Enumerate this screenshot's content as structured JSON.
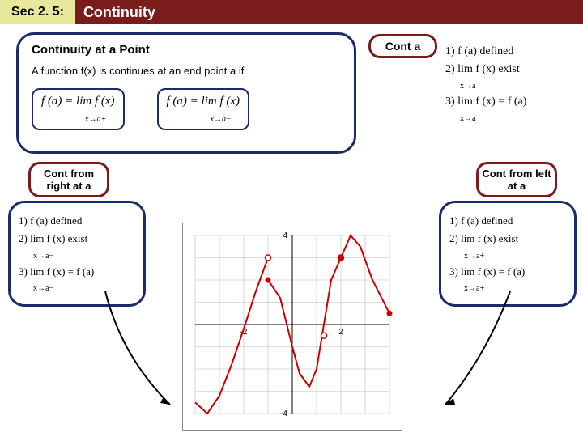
{
  "header": {
    "section_label": "Sec 2. 5:",
    "title": "Continuity"
  },
  "top_box": {
    "title": "Continuity at a Point",
    "description": "A  function  f(x)  is continues at an end point  a  if",
    "eq_left": "f (a) = lim  f (x)",
    "eq_left_sub": "x→a+",
    "eq_right": "f (a) = lim  f (x)",
    "eq_right_sub": "x→a−"
  },
  "cont_a_label": "Cont  a",
  "cont_right_label": "Cont from right at a",
  "cont_left_label": "Cont from left at a",
  "conditions_a": {
    "c1": "1) f (a)  defined",
    "c2": "2) lim f (x)  exist",
    "c2_sub": "x→a",
    "c3": "3) lim f (x) = f (a)",
    "c3_sub": "x→a"
  },
  "conditions_left_panel": {
    "c1": "1) f (a)  defined",
    "c2": "2) lim f (x)  exist",
    "c2_sub": "x→a−",
    "c3": "3) lim f (x) = f (a)",
    "c3_sub": "x→a−"
  },
  "conditions_right_panel": {
    "c1": "1) f (a)  defined",
    "c2": "2) lim f (x)  exist",
    "c2_sub": "x→a+",
    "c3": "3) lim f (x) = f (a)",
    "c3_sub": "x→a+"
  },
  "chart_data": {
    "type": "line",
    "title": "",
    "xlabel": "",
    "ylabel": "",
    "xlim": [
      -4,
      4
    ],
    "ylim": [
      -4,
      4
    ],
    "x_ticks": [
      -2,
      2
    ],
    "y_ticks": [
      -4,
      4
    ],
    "segments": [
      {
        "name": "piece1",
        "points": [
          [
            -4,
            -3.5
          ],
          [
            -3.5,
            -4
          ],
          [
            -3,
            -3.2
          ],
          [
            -2.5,
            -1.8
          ],
          [
            -2,
            -0.2
          ],
          [
            -1.5,
            1.5
          ],
          [
            -1,
            3
          ]
        ],
        "end_open": true
      },
      {
        "name": "piece2",
        "points": [
          [
            -1,
            2
          ],
          [
            -0.5,
            1.2
          ],
          [
            0,
            -1
          ],
          [
            0.3,
            -2.2
          ],
          [
            0.7,
            -2.8
          ],
          [
            1,
            -2
          ],
          [
            1.3,
            0
          ],
          [
            1.6,
            2
          ],
          [
            2,
            3
          ]
        ],
        "start_closed": true,
        "end_open": true
      },
      {
        "name": "piece3",
        "points": [
          [
            2,
            3
          ],
          [
            2.4,
            4
          ],
          [
            2.8,
            3.5
          ],
          [
            3.3,
            2
          ],
          [
            4,
            0.5
          ]
        ],
        "start_closed": true,
        "end_closed": true
      }
    ],
    "isolated_point": [
      1.3,
      -0.5
    ]
  }
}
